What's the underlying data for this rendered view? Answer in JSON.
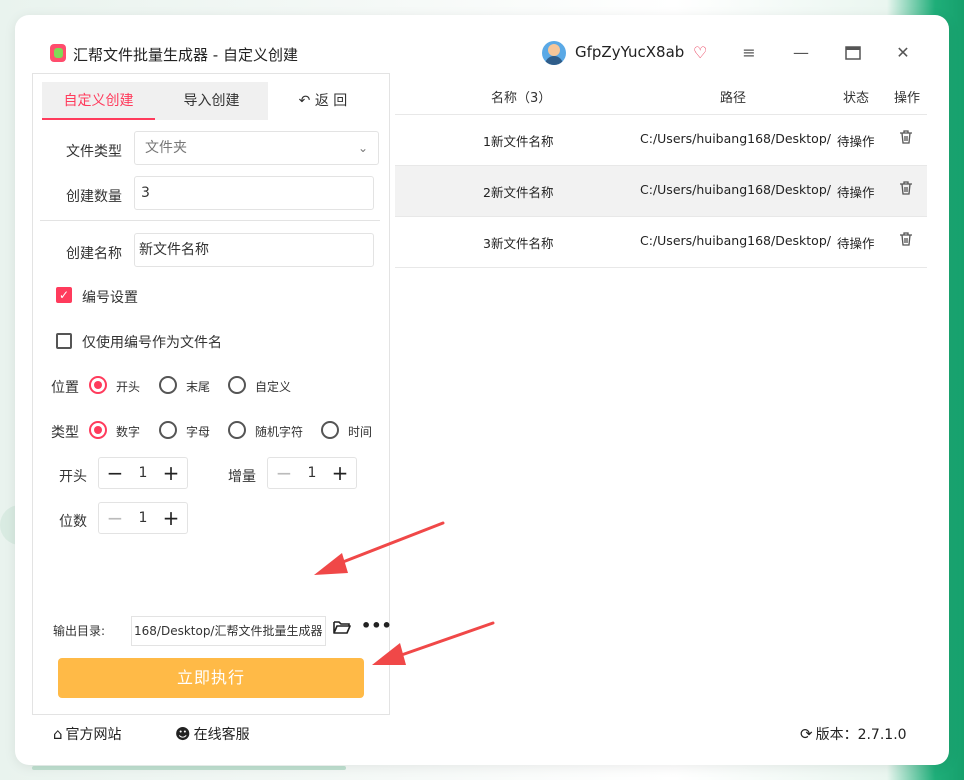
{
  "window": {
    "title": "汇帮文件批量生成器 - 自定义创建",
    "username": "GfpZyYucX8ab",
    "icons": [
      "menu-icon",
      "minimize-icon",
      "maximize-icon",
      "close-icon"
    ]
  },
  "tabs": {
    "custom": "自定义创建",
    "import": "导入创建",
    "back": "返 回"
  },
  "form": {
    "file_type_label": "文件类型",
    "file_type_value": "文件夹",
    "count_label": "创建数量",
    "count_value": "3",
    "name_label": "创建名称",
    "name_value": "新文件名称",
    "numbering_label": "编号设置",
    "numbering_checked": true,
    "only_number_label": "仅使用编号作为文件名",
    "only_number_checked": false,
    "position_label": "位置",
    "position_options": [
      "开头",
      "末尾",
      "自定义"
    ],
    "position_selected": "开头",
    "type_label": "类型",
    "type_options": [
      "数字",
      "字母",
      "随机字符",
      "时间"
    ],
    "type_selected": "数字",
    "start_label": "开头",
    "start_value": "1",
    "increment_label": "增量",
    "increment_value": "1",
    "digits_label": "位数",
    "digits_value": "1",
    "output_label": "输出目录:",
    "output_value": "168/Desktop/汇帮文件批量生成器",
    "execute_label": "立即执行"
  },
  "table": {
    "headers": [
      "名称（3）",
      "路径",
      "状态",
      "操作"
    ],
    "rows": [
      {
        "name": "1新文件名称",
        "path": "C:/Users/huibang168/Desktop/",
        "status": "待操作"
      },
      {
        "name": "2新文件名称",
        "path": "C:/Users/huibang168/Desktop/",
        "status": "待操作"
      },
      {
        "name": "3新文件名称",
        "path": "C:/Users/huibang168/Desktop/",
        "status": "待操作"
      }
    ]
  },
  "footer": {
    "website": "官方网站",
    "support": "在线客服",
    "version": "版本：2.7.1.0"
  },
  "colors": {
    "accent": "#ff3b5c",
    "execute_button": "#ffba47",
    "arrow": "#f04848"
  }
}
